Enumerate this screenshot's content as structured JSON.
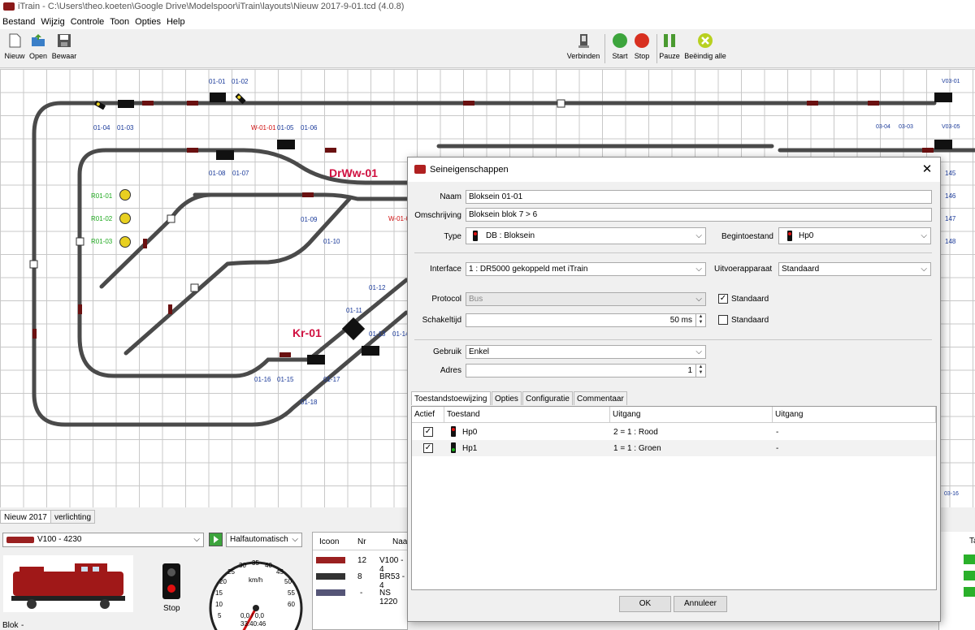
{
  "window": {
    "title": "iTrain - C:\\Users\\theo.koeten\\Google Drive\\Modelspoor\\iTrain\\layouts\\Nieuw 2017-9-01.tcd (4.0.8)"
  },
  "menu": [
    "Bestand",
    "Wijzig",
    "Controle",
    "Toon",
    "Opties",
    "Help"
  ],
  "toolbar": {
    "new": "Nieuw",
    "open": "Open",
    "save": "Bewaar",
    "connect": "Verbinden",
    "start": "Start",
    "stop": "Stop",
    "pause": "Pauze",
    "end_all": "Beëindig alle"
  },
  "layout_labels": {
    "blue": [
      "01-01",
      "01-02",
      "01-04",
      "01-03",
      "01-05",
      "01-06",
      "01-08",
      "01-07",
      "01-09",
      "01-10",
      "01-12",
      "01-11",
      "01-13",
      "01-14",
      "01-16",
      "01-15",
      "01-17",
      "01-18",
      "03-04",
      "03-03",
      "V03-01",
      "V03-05",
      "03-16"
    ],
    "red": [
      "W-01-01",
      "W-01-0"
    ],
    "green": [
      "R01-01",
      "R01-02",
      "R01-03"
    ],
    "big": [
      "DrWw-01",
      "Kr-01"
    ],
    "right": [
      "145",
      "146",
      "147",
      "148"
    ]
  },
  "bottom_tabs": [
    "Nieuw 2017",
    "verlichting"
  ],
  "loco": {
    "selected": "V100 - 4230",
    "mode": "Halfautomatisch",
    "stop_label": "Stop",
    "block_label": "Blok",
    "block_value": "-",
    "speed_unit": "km/h",
    "speed_value": "0,0 / 0,0",
    "time": "33:40:46",
    "dial_numbers": [
      "5",
      "10",
      "15",
      "20",
      "25",
      "30",
      "35",
      "40",
      "45",
      "50",
      "55",
      "60"
    ]
  },
  "loco_table": {
    "headers": [
      "Icoon",
      "Nr",
      "Naa"
    ],
    "rows": [
      {
        "nr": "12",
        "name": "V100 - 4"
      },
      {
        "nr": "8",
        "name": "BR53 - 4"
      },
      {
        "nr": "-",
        "name": "NS 1220"
      }
    ],
    "right_header": "Ta"
  },
  "dialog": {
    "title": "Seineigenschappen",
    "name_label": "Naam",
    "name_value": "Bloksein 01-01",
    "desc_label": "Omschrijving",
    "desc_value": "Bloksein blok 7 > 6",
    "type_label": "Type",
    "type_value": "DB : Bloksein",
    "begin_label": "Begintoestand",
    "begin_value": "Hp0",
    "interface_label": "Interface",
    "interface_value": "1 : DR5000 gekoppeld met iTrain",
    "output_label": "Uitvoerapparaat",
    "output_value": "Standaard",
    "protocol_label": "Protocol",
    "protocol_value": "Bus",
    "std1": "Standaard",
    "std2": "Standaard",
    "switch_label": "Schakeltijd",
    "switch_value": "50 ms",
    "use_label": "Gebruik",
    "use_value": "Enkel",
    "addr_label": "Adres",
    "addr_value": "1",
    "tabs": [
      "Toestandstoewijzing",
      "Opties",
      "Configuratie",
      "Commentaar"
    ],
    "table_headers": [
      "Actief",
      "Toestand",
      "Uitgang",
      "Uitgang"
    ],
    "rows": [
      {
        "state": "Hp0",
        "out1": "2 = 1 : Rood",
        "out2": "-"
      },
      {
        "state": "Hp1",
        "out1": "1 = 1 : Groen",
        "out2": "-"
      }
    ],
    "ok": "OK",
    "cancel": "Annuleer"
  },
  "colors": {
    "track": "#4a4a4a",
    "block": "#8b1a1a",
    "blue_label": "#1a3a9a",
    "red_label": "#d01010",
    "green_label": "#1fa91f",
    "accent": "#d01040"
  }
}
